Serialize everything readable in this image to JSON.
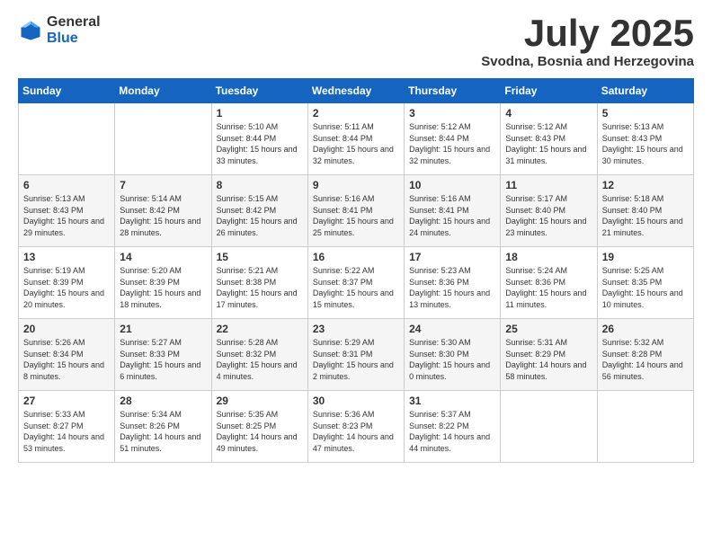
{
  "header": {
    "logo_general": "General",
    "logo_blue": "Blue",
    "month_title": "July 2025",
    "location": "Svodna, Bosnia and Herzegovina"
  },
  "days_of_week": [
    "Sunday",
    "Monday",
    "Tuesday",
    "Wednesday",
    "Thursday",
    "Friday",
    "Saturday"
  ],
  "weeks": [
    [
      {
        "day": "",
        "content": ""
      },
      {
        "day": "",
        "content": ""
      },
      {
        "day": "1",
        "content": "Sunrise: 5:10 AM\nSunset: 8:44 PM\nDaylight: 15 hours and 33 minutes."
      },
      {
        "day": "2",
        "content": "Sunrise: 5:11 AM\nSunset: 8:44 PM\nDaylight: 15 hours and 32 minutes."
      },
      {
        "day": "3",
        "content": "Sunrise: 5:12 AM\nSunset: 8:44 PM\nDaylight: 15 hours and 32 minutes."
      },
      {
        "day": "4",
        "content": "Sunrise: 5:12 AM\nSunset: 8:43 PM\nDaylight: 15 hours and 31 minutes."
      },
      {
        "day": "5",
        "content": "Sunrise: 5:13 AM\nSunset: 8:43 PM\nDaylight: 15 hours and 30 minutes."
      }
    ],
    [
      {
        "day": "6",
        "content": "Sunrise: 5:13 AM\nSunset: 8:43 PM\nDaylight: 15 hours and 29 minutes."
      },
      {
        "day": "7",
        "content": "Sunrise: 5:14 AM\nSunset: 8:42 PM\nDaylight: 15 hours and 28 minutes."
      },
      {
        "day": "8",
        "content": "Sunrise: 5:15 AM\nSunset: 8:42 PM\nDaylight: 15 hours and 26 minutes."
      },
      {
        "day": "9",
        "content": "Sunrise: 5:16 AM\nSunset: 8:41 PM\nDaylight: 15 hours and 25 minutes."
      },
      {
        "day": "10",
        "content": "Sunrise: 5:16 AM\nSunset: 8:41 PM\nDaylight: 15 hours and 24 minutes."
      },
      {
        "day": "11",
        "content": "Sunrise: 5:17 AM\nSunset: 8:40 PM\nDaylight: 15 hours and 23 minutes."
      },
      {
        "day": "12",
        "content": "Sunrise: 5:18 AM\nSunset: 8:40 PM\nDaylight: 15 hours and 21 minutes."
      }
    ],
    [
      {
        "day": "13",
        "content": "Sunrise: 5:19 AM\nSunset: 8:39 PM\nDaylight: 15 hours and 20 minutes."
      },
      {
        "day": "14",
        "content": "Sunrise: 5:20 AM\nSunset: 8:39 PM\nDaylight: 15 hours and 18 minutes."
      },
      {
        "day": "15",
        "content": "Sunrise: 5:21 AM\nSunset: 8:38 PM\nDaylight: 15 hours and 17 minutes."
      },
      {
        "day": "16",
        "content": "Sunrise: 5:22 AM\nSunset: 8:37 PM\nDaylight: 15 hours and 15 minutes."
      },
      {
        "day": "17",
        "content": "Sunrise: 5:23 AM\nSunset: 8:36 PM\nDaylight: 15 hours and 13 minutes."
      },
      {
        "day": "18",
        "content": "Sunrise: 5:24 AM\nSunset: 8:36 PM\nDaylight: 15 hours and 11 minutes."
      },
      {
        "day": "19",
        "content": "Sunrise: 5:25 AM\nSunset: 8:35 PM\nDaylight: 15 hours and 10 minutes."
      }
    ],
    [
      {
        "day": "20",
        "content": "Sunrise: 5:26 AM\nSunset: 8:34 PM\nDaylight: 15 hours and 8 minutes."
      },
      {
        "day": "21",
        "content": "Sunrise: 5:27 AM\nSunset: 8:33 PM\nDaylight: 15 hours and 6 minutes."
      },
      {
        "day": "22",
        "content": "Sunrise: 5:28 AM\nSunset: 8:32 PM\nDaylight: 15 hours and 4 minutes."
      },
      {
        "day": "23",
        "content": "Sunrise: 5:29 AM\nSunset: 8:31 PM\nDaylight: 15 hours and 2 minutes."
      },
      {
        "day": "24",
        "content": "Sunrise: 5:30 AM\nSunset: 8:30 PM\nDaylight: 15 hours and 0 minutes."
      },
      {
        "day": "25",
        "content": "Sunrise: 5:31 AM\nSunset: 8:29 PM\nDaylight: 14 hours and 58 minutes."
      },
      {
        "day": "26",
        "content": "Sunrise: 5:32 AM\nSunset: 8:28 PM\nDaylight: 14 hours and 56 minutes."
      }
    ],
    [
      {
        "day": "27",
        "content": "Sunrise: 5:33 AM\nSunset: 8:27 PM\nDaylight: 14 hours and 53 minutes."
      },
      {
        "day": "28",
        "content": "Sunrise: 5:34 AM\nSunset: 8:26 PM\nDaylight: 14 hours and 51 minutes."
      },
      {
        "day": "29",
        "content": "Sunrise: 5:35 AM\nSunset: 8:25 PM\nDaylight: 14 hours and 49 minutes."
      },
      {
        "day": "30",
        "content": "Sunrise: 5:36 AM\nSunset: 8:23 PM\nDaylight: 14 hours and 47 minutes."
      },
      {
        "day": "31",
        "content": "Sunrise: 5:37 AM\nSunset: 8:22 PM\nDaylight: 14 hours and 44 minutes."
      },
      {
        "day": "",
        "content": ""
      },
      {
        "day": "",
        "content": ""
      }
    ]
  ]
}
